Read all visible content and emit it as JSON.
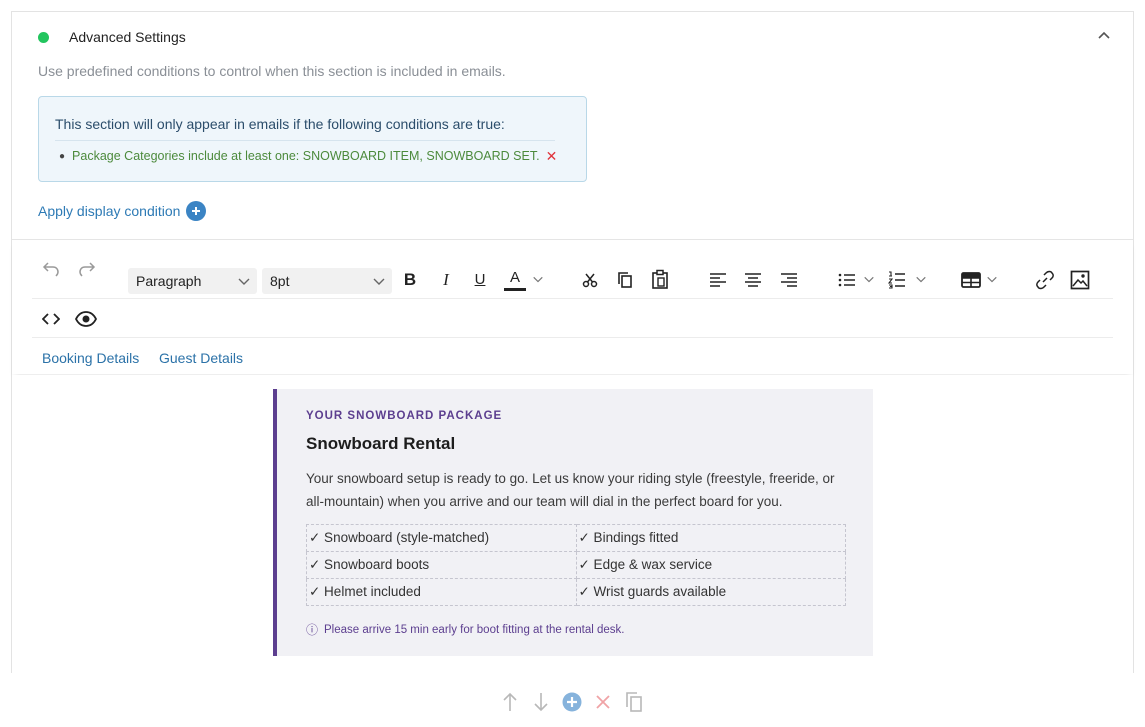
{
  "section": {
    "title": "Advanced Settings",
    "status_color": "#22c55e",
    "description": "Use predefined conditions to control when this section is included in emails."
  },
  "conditions": {
    "heading": "This section will only appear in emails if the following conditions are true:",
    "items": [
      {
        "text": "Package Categories include at least one: SNOWBOARD ITEM, SNOWBOARD SET.",
        "remove": "✕"
      }
    ],
    "apply_label": "Apply display condition"
  },
  "toolbar": {
    "block_format": "Paragraph",
    "font_size": "8pt",
    "icons": [
      "undo-icon",
      "redo-icon",
      "bold-icon",
      "italic-icon",
      "underline-icon",
      "text-color-icon",
      "cut-icon",
      "copy-icon",
      "paste-icon",
      "align-left-icon",
      "align-center-icon",
      "align-right-icon",
      "bullet-list-icon",
      "numbered-list-icon",
      "table-icon",
      "link-icon",
      "image-icon",
      "code-icon",
      "preview-icon"
    ],
    "bold": "B",
    "italic": "I",
    "underline": "U",
    "text_color": "A"
  },
  "merge_tabs": [
    "Booking Details",
    "Guest Details"
  ],
  "content": {
    "kicker": "YOUR SNOWBOARD PACKAGE",
    "title": "Snowboard Rental",
    "body": "Your snowboard setup is ready to go. Let us know your riding style (freestyle, freeride, or all-mountain) when you arrive and our team will dial in the perfect board for you.",
    "table": [
      [
        "✓ Snowboard (style-matched)",
        "✓ Bindings fitted"
      ],
      [
        "✓ Snowboard boots",
        "✓ Edge & wax service"
      ],
      [
        "✓ Helmet included",
        "✓ Wrist guards available"
      ]
    ],
    "note_icon": "ⓘ",
    "note": "Please arrive 15 min early for boot fitting at the rental desk.",
    "accent_color": "#5c3e8f"
  },
  "footer_actions": [
    "move-up-icon",
    "move-down-icon",
    "add-icon",
    "delete-icon",
    "duplicate-icon"
  ]
}
